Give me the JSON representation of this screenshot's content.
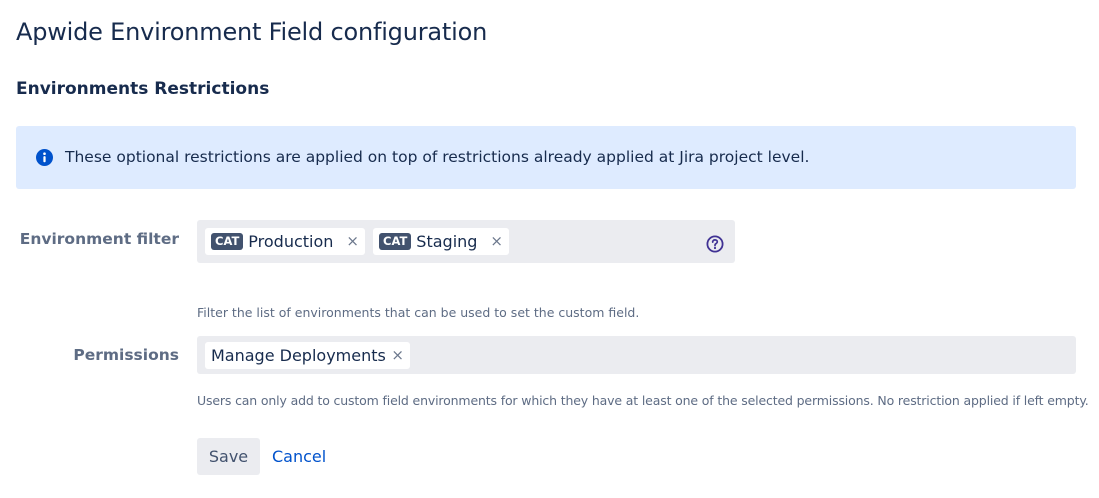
{
  "page": {
    "title": "Apwide Environment Field configuration"
  },
  "section": {
    "title": "Environments Restrictions"
  },
  "info_banner": {
    "icon": "info-icon",
    "text": "These optional restrictions are applied on top of restrictions already applied at Jira project level."
  },
  "environment_filter": {
    "label": "Environment filter",
    "chips": [
      {
        "badge": "CAT",
        "label": "Production",
        "remove": "×"
      },
      {
        "badge": "CAT",
        "label": "Staging",
        "remove": "×"
      }
    ],
    "help_icon": "question-circle-icon",
    "help_text": "Filter the list of environments that can be used to set the custom field."
  },
  "permissions": {
    "label": "Permissions",
    "chips": [
      {
        "label": "Manage Deployments",
        "remove": "×"
      }
    ],
    "help_text": "Users can only add to custom field environments for which they have at least one of the selected permissions. No restriction applied if left empty."
  },
  "actions": {
    "save_label": "Save",
    "cancel_label": "Cancel"
  },
  "colors": {
    "banner_bg": "#deebff",
    "info_icon": "#0052cc",
    "badge_bg": "#42526e",
    "link": "#0052cc",
    "select_bg": "#ebecf0"
  }
}
